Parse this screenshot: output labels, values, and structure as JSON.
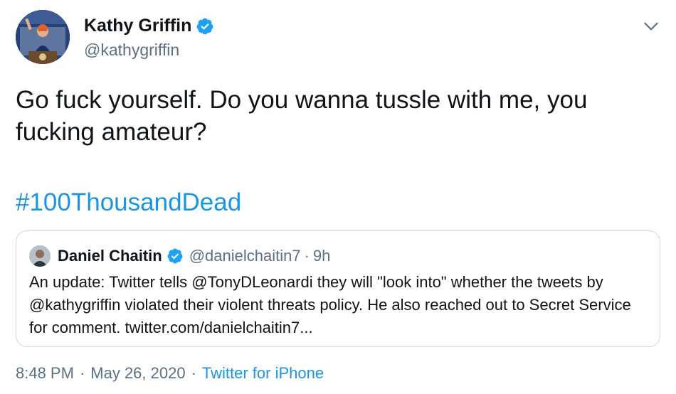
{
  "author": {
    "name": "Kathy Griffin",
    "handle": "@kathygriffin",
    "verified": true,
    "avatar_icon": "profile-photo-woman-at-podium"
  },
  "tweet": {
    "text": "Go fuck yourself. Do you wanna tussle with me, you fucking amateur?",
    "hashtag": "#100ThousandDead"
  },
  "quoted_tweet": {
    "name": "Daniel Chaitin",
    "handle": "@danielchaitin7",
    "separator": "·",
    "time": "9h",
    "verified": true,
    "text": "An update: Twitter tells @TonyDLeonardi they will \"look into\" whether the tweets by @kathygriffin violated their violent threats policy. He also reached out to Secret Service for comment. twitter.com/danielchaitin7..."
  },
  "meta": {
    "time": "8:48 PM",
    "separator": "·",
    "date": "May 26, 2020",
    "source": "Twitter for iPhone"
  },
  "colors": {
    "link": "#1b95e0",
    "secondary_text": "#5b7083",
    "border": "#cfd9de",
    "verified": "#1da1f2"
  }
}
